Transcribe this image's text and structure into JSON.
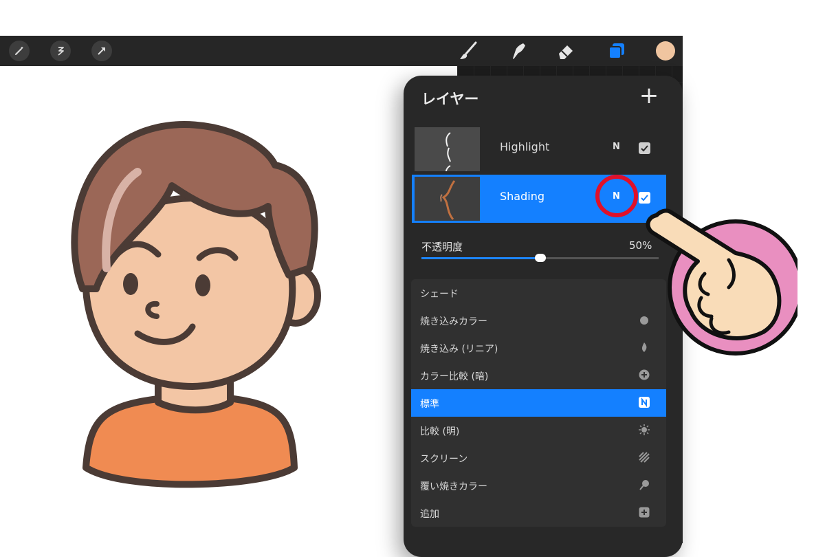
{
  "colors": {
    "accent": "#1480ff",
    "toolbar": "#262626",
    "panel": "#282828",
    "highlight_ring": "#e0102a",
    "color_swatch": "#f0c5a0"
  },
  "toolbar": {
    "left_icons": [
      "magic-wand-icon",
      "selection-icon",
      "transform-arrow-icon"
    ],
    "right_icons": [
      "brush-icon",
      "smudge-icon",
      "eraser-icon",
      "layers-icon",
      "color-swatch-icon"
    ]
  },
  "layers_panel": {
    "title": "レイヤー",
    "add_icon": "plus-icon",
    "layers": [
      {
        "name": "Highlight",
        "blend": "N",
        "visible": true,
        "selected": false
      },
      {
        "name": "Shading",
        "blend": "N",
        "visible": true,
        "selected": true
      }
    ],
    "opacity": {
      "label": "不透明度",
      "value_text": "50%",
      "fraction": 0.5
    },
    "blend_modes": [
      {
        "label": "シェード",
        "icon": "",
        "selected": false
      },
      {
        "label": "焼き込みカラー",
        "icon": "burn-icon",
        "selected": false
      },
      {
        "label": "焼き込み (リニア)",
        "icon": "flame-icon",
        "selected": false
      },
      {
        "label": "カラー比較 (暗)",
        "icon": "plus-circle-icon",
        "selected": false
      },
      {
        "label": "標準",
        "icon": "n-badge-icon",
        "selected": true
      },
      {
        "label": "比較 (明)",
        "icon": "sun-icon",
        "selected": false
      },
      {
        "label": "スクリーン",
        "icon": "striped-square-icon",
        "selected": false
      },
      {
        "label": "覆い焼きカラー",
        "icon": "lollipop-icon",
        "selected": false
      },
      {
        "label": "追加",
        "icon": "plus-square-icon",
        "selected": false
      }
    ]
  }
}
